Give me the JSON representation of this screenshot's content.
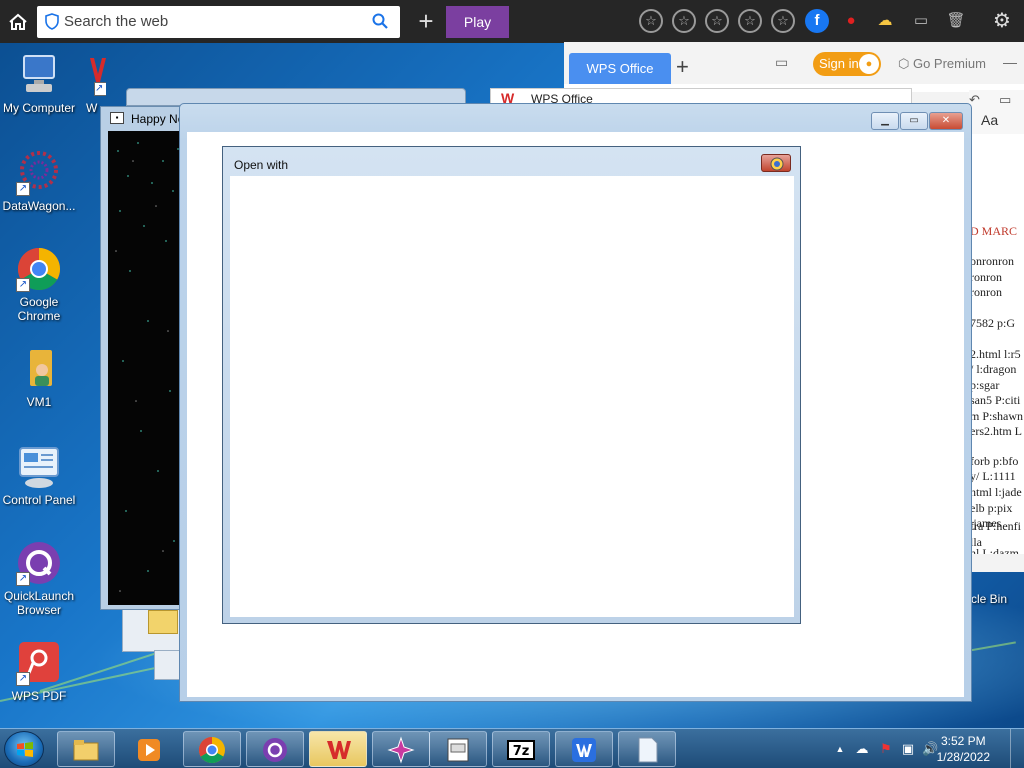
{
  "toolbar": {
    "search_placeholder": "Search the web",
    "play_label": "Play"
  },
  "desktop": {
    "icons": [
      {
        "label": "My Computer"
      },
      {
        "label": "DataWagon..."
      },
      {
        "label": "Google\nChrome"
      },
      {
        "label": "VM1"
      },
      {
        "label": "Control Panel"
      },
      {
        "label": "QuickLaunch\nBrowser"
      },
      {
        "label": "WPS PDF"
      }
    ],
    "partial_icon_label": "W",
    "recycle_partial_label": "cle Bin"
  },
  "wps": {
    "tab_label": "WPS Office",
    "window_title": "WPS Office",
    "sign_in": "Sign in",
    "go_premium": "Go Premium",
    "font_btn": "Aa",
    "doc_lines": [
      "D MARC",
      "onronron",
      "ronron",
      "ronron",
      "7582 p:G",
      "2.html l:r5",
      "/ l:dragon",
      " p:sgar",
      "san5 P:citi",
      "m P:shawn",
      "ers2.htm L",
      "forb p:bfo",
      "y/ L:1111",
      "html l:jade",
      "elb p:pix",
      ":james",
      "nl L:dazm",
      "fra P:henfi",
      "lla"
    ]
  },
  "happy_window": {
    "title": "Happy Ne"
  },
  "main_window": {},
  "open_with": {
    "title": "Open with"
  },
  "taskbar": {
    "clock_time": "3:52 PM",
    "clock_date": "1/28/2022"
  },
  "colors": {
    "play": "#7b3fa0",
    "wps_tab": "#4a8ff0",
    "sign_in": "#f29d14"
  }
}
